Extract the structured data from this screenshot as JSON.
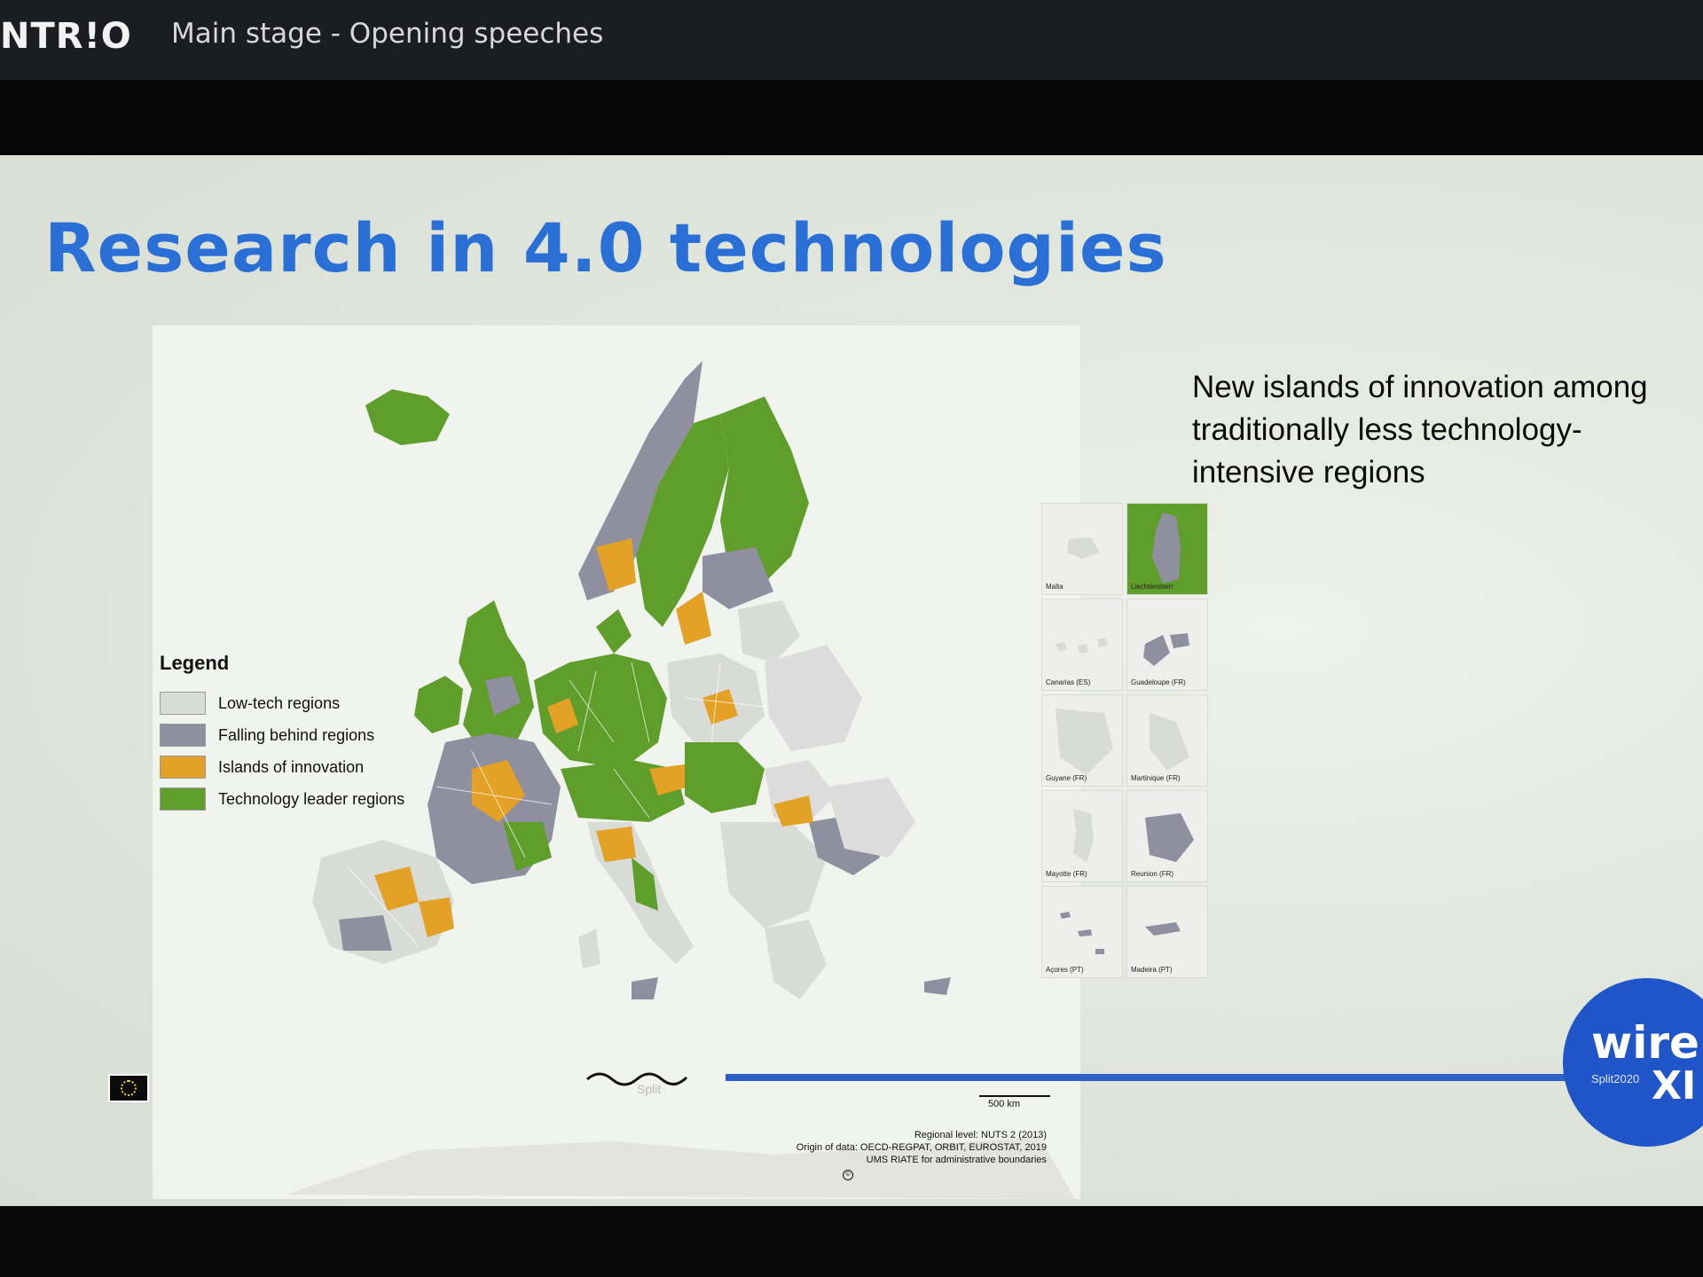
{
  "header": {
    "logo_text": "NTR!O",
    "stage_title": "Main stage - Opening speeches"
  },
  "slide": {
    "title": "Research in 4.0 technologies",
    "side_text": "New islands of innovation among traditionally less technology-intensive regions",
    "legend": {
      "title": "Legend",
      "items": [
        {
          "label": "Low-tech regions",
          "color": "#d9dbd6"
        },
        {
          "label": "Falling behind regions",
          "color": "#8f8f9f"
        },
        {
          "label": "Islands of innovation",
          "color": "#e3a226"
        },
        {
          "label": "Technology leader regions",
          "color": "#5f9e2a"
        }
      ]
    },
    "insets": [
      {
        "label": "Malta"
      },
      {
        "label": "Liechtenstein"
      },
      {
        "label": "Canarias (ES)"
      },
      {
        "label": "Guadeloupe (FR)"
      },
      {
        "label": "Guyane (FR)"
      },
      {
        "label": "Martinique (FR)"
      },
      {
        "label": "Mayotte (FR)"
      },
      {
        "label": "Reunion (FR)"
      },
      {
        "label": "Açores (PT)"
      },
      {
        "label": "Madeira (PT)"
      }
    ],
    "scale_label": "500 km",
    "source_lines": [
      "Regional level: NUTS 2 (2013)",
      "Origin of data: OECD-REGPAT, ORBIT, EUROSTAT, 2019",
      "UMS RIATE for administrative boundaries"
    ],
    "copyright_symbol": "©",
    "split_text": "Split",
    "badge": {
      "wire": "wire",
      "split_year": "Split2020",
      "numeral": "XI"
    }
  },
  "colors": {
    "title_blue": "#2a6fd6",
    "accent_blue": "#2d5fc4"
  }
}
